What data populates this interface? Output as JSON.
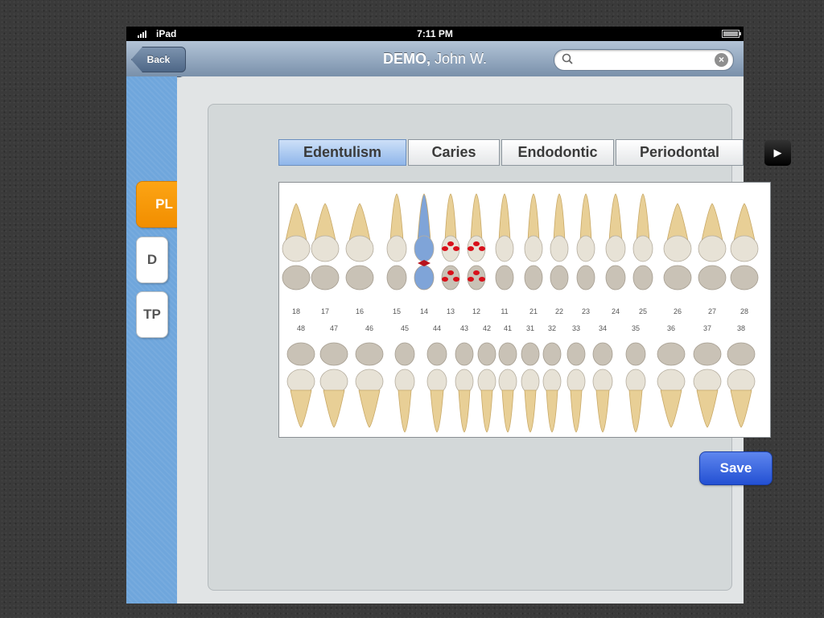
{
  "status_bar": {
    "carrier": "iPad",
    "time": "7:11 PM"
  },
  "nav": {
    "back_label": "Back",
    "title_last": "DEMO,",
    "title_first": "John W.",
    "search_placeholder": "",
    "search_icon": "search-icon",
    "clear_icon": "clear-icon"
  },
  "sidebar": {
    "items": [
      "PL",
      "D",
      "TP"
    ],
    "active": "PL"
  },
  "tabs": [
    "Edentulism",
    "Caries",
    "Endodontic",
    "Periodontal"
  ],
  "active_tab": "Edentulism",
  "tab_next_icon": "chevron-right-icon",
  "tooth_chart": {
    "upper_numbers": [
      "18",
      "17",
      "16",
      "15",
      "14",
      "13",
      "12",
      "11",
      "21",
      "22",
      "23",
      "24",
      "25",
      "26",
      "27",
      "28"
    ],
    "lower_numbers": [
      "48",
      "47",
      "46",
      "45",
      "44",
      "43",
      "42",
      "41",
      "31",
      "32",
      "33",
      "34",
      "35",
      "36",
      "37",
      "38"
    ],
    "selected_teeth": [
      "14"
    ],
    "caries_marked_teeth": [
      "13",
      "12"
    ]
  },
  "colors": {
    "accent_orange": "#f7960a",
    "save_blue": "#2f5fdc",
    "tab_active": "#a9c8f0",
    "sidebar_blue": "#6fa6dc",
    "selection_blue": "#7fa4d8",
    "caries_red": "#d8101a"
  },
  "save_label": "Save"
}
